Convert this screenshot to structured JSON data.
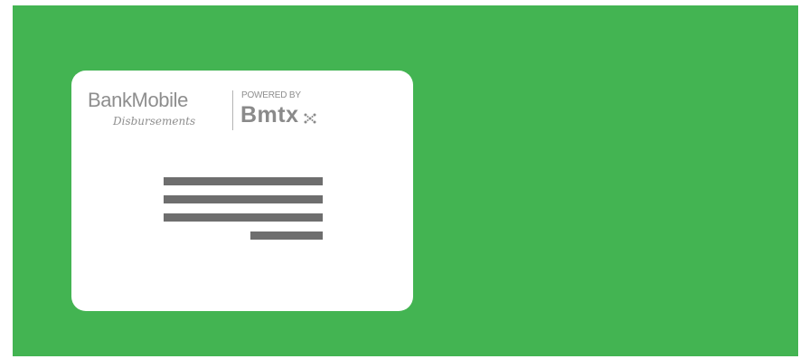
{
  "envelope": {
    "background_color": "#43b452",
    "window_color": "#ffffff",
    "line_color": "#6e6e6e"
  },
  "logo": {
    "brand": "BankMobile",
    "sub": "Disbursements",
    "powered_by": "POWERED BY",
    "partner": "Bmtx"
  },
  "address_block": {
    "line_count": 4
  }
}
